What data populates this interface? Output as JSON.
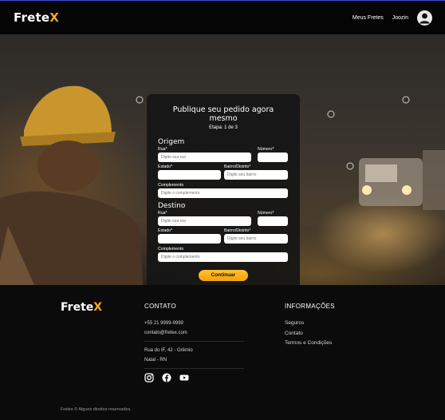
{
  "header": {
    "logo_main": "Frete",
    "logo_accent": "X",
    "nav_meus_fretes": "Meus Fretes",
    "user_name": "Joozin"
  },
  "form": {
    "title": "Publique seu pedido agora mesmo",
    "step": "Etapa: 1 de 3",
    "origem": {
      "section": "Origem",
      "rua_label": "Rua*",
      "rua_placeholder": "Digite sua rua",
      "numero_label": "Número*",
      "estado_label": "Estado*",
      "bairro_label": "Bairro/Distrito*",
      "bairro_placeholder": "Digite seu bairro",
      "complemento_label": "Complemento",
      "complemento_placeholder": "Digite o complemento"
    },
    "destino": {
      "section": "Destino",
      "rua_label": "Rua*",
      "rua_placeholder": "Digite sua rua",
      "numero_label": "Número*",
      "estado_label": "Estado*",
      "bairro_label": "Bairro/Distrito*",
      "bairro_placeholder": "Digite seu bairro",
      "complemento_label": "Complemento",
      "complemento_placeholder": "Digite o complemento"
    },
    "submit_label": "Continuar"
  },
  "footer": {
    "logo_main": "Frete",
    "logo_accent": "X",
    "contato": {
      "heading": "CONTATO",
      "phone": "+55 21 9999-9999",
      "email": "contato@fretex.com",
      "address_line1": "Rua do IF, 42 - Grêmio",
      "address_line2": "Natal - RN"
    },
    "informacoes": {
      "heading": "INFORMAÇÕES",
      "links": [
        "Seguros",
        "Contato",
        "Termos e Condições"
      ]
    },
    "copyright": "Fretex © Alguns direitos reservados."
  },
  "colors": {
    "accent": "#f5a623",
    "button": "#f2a20c",
    "background": "#0b0b0b"
  },
  "icons": [
    "user-avatar-icon",
    "instagram-icon",
    "facebook-icon",
    "youtube-icon",
    "map-pin-icon"
  ]
}
